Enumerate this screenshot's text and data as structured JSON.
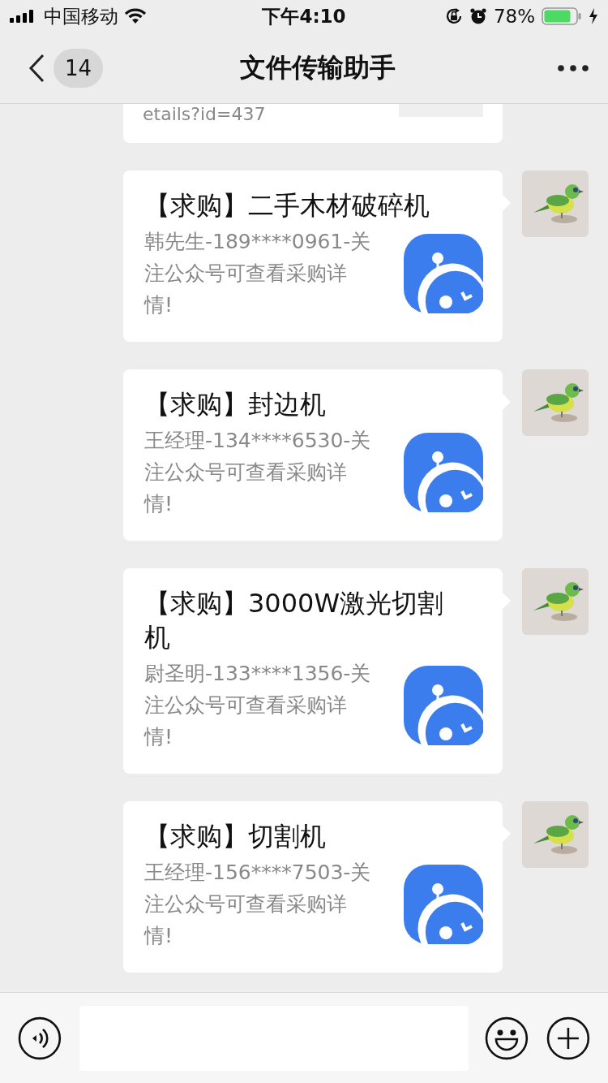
{
  "status_bar": {
    "carrier": "中国移动",
    "time": "下午4:10",
    "battery": "78%"
  },
  "nav": {
    "back_count": "14",
    "title": "文件传输助手"
  },
  "messages": [
    {
      "kind": "partial",
      "text": "etails?id=437"
    },
    {
      "kind": "card",
      "title": "【求购】二手木材破碎机",
      "description": "韩先生-189****0961-关注公众号可查看采购详情!"
    },
    {
      "kind": "card",
      "title": "【求购】封边机",
      "description": "王经理-134****6530-关注公众号可查看采购详情!"
    },
    {
      "kind": "card",
      "title": "【求购】3000W激光切割机",
      "description": "尉圣明-133****1356-关注公众号可查看采购详情!"
    },
    {
      "kind": "card",
      "title": "【求购】切割机",
      "description": "王经理-156****7503-关注公众号可查看采购详情!"
    }
  ]
}
